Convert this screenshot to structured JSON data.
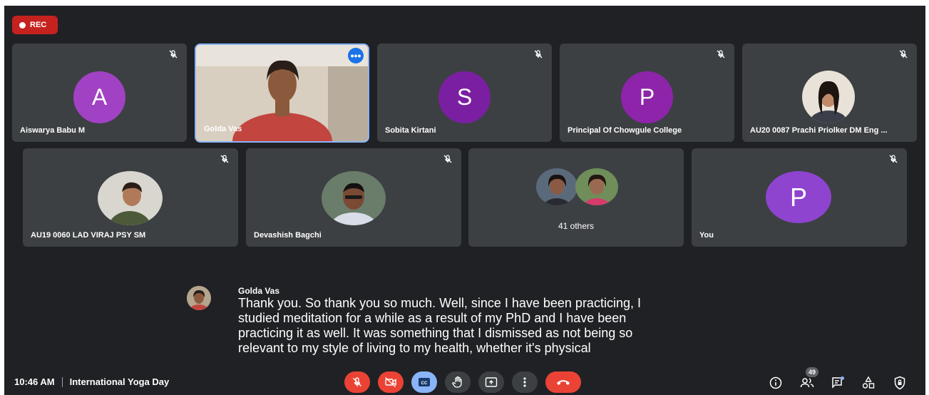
{
  "recording": {
    "label": "REC"
  },
  "participants": [
    {
      "name": "Aiswarya Babu M",
      "initial": "A",
      "avatar_color": "#a142c4",
      "muted": true
    },
    {
      "name": "Golda Vas",
      "video": true,
      "speaking": true
    },
    {
      "name": "Sobita Kirtani",
      "initial": "S",
      "avatar_color": "#7b1fa2",
      "muted": true
    },
    {
      "name": "Principal Of Chowgule College",
      "initial": "P",
      "avatar_color": "#8e24aa",
      "muted": true
    },
    {
      "name": "AU20 0087 Prachi Priolker DM Eng ...",
      "photo": true,
      "muted": true
    },
    {
      "name": "AU19 0060 LAD VIRAJ PSY SM",
      "photo": true,
      "muted": true
    },
    {
      "name": "Devashish Bagchi",
      "photo": true,
      "muted": true
    },
    {
      "name": "41 others",
      "group": true
    },
    {
      "name": "You",
      "initial": "P",
      "avatar_color": "#8e44cf",
      "muted": true
    }
  ],
  "caption": {
    "speaker": "Golda Vas",
    "lines": [
      "Thank you. So thank you so much. Well, since I have been practicing, I",
      "studied meditation for a while as a result of my PhD and I have been",
      "practicing it as well. It was something that I dismissed as not being so",
      "relevant to my style of living to my health, whether it's physical"
    ]
  },
  "meeting": {
    "time": "10:46 AM",
    "title": "International Yoga Day"
  },
  "controls": [
    "mic-off",
    "camera-off",
    "captions",
    "raise-hand",
    "present",
    "more-options",
    "leave-call"
  ],
  "right_controls": {
    "people_count": "49"
  },
  "colors": {
    "background": "#202124",
    "tile": "#3c4043",
    "danger": "#ea4335",
    "accent": "#8ab4f8"
  }
}
